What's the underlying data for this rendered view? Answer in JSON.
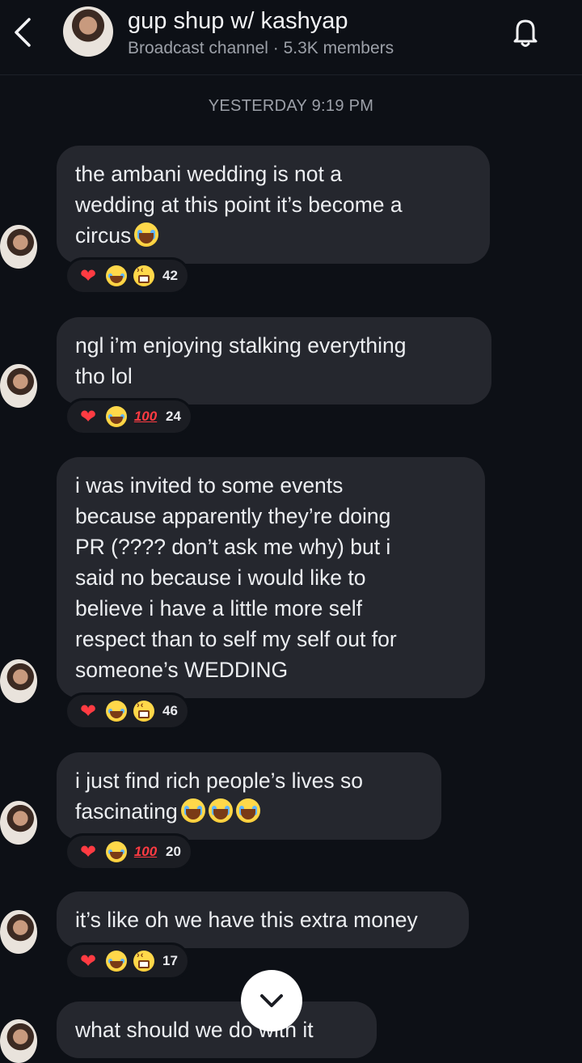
{
  "header": {
    "back_icon": "chevron-left-icon",
    "channel_name": "gup shup w/ kashyap",
    "subtitle": "Broadcast channel · 5.3K members",
    "bell_icon": "bell-icon"
  },
  "timestamp": "YESTERDAY 9:19 PM",
  "messages": [
    {
      "text": "the ambani wedding is not a\nwedding at this point it’s become a\ncircus",
      "emojis": [
        "loudly-crying-face"
      ],
      "reactions": [
        "heart",
        "face-with-tears-of-joy",
        "grinning-squinting-face"
      ],
      "count": "42"
    },
    {
      "text": "ngl i’m enjoying stalking everything\ntho lol",
      "emojis": [],
      "reactions": [
        "heart",
        "face-with-tears-of-joy",
        "hundred-points"
      ],
      "count": "24"
    },
    {
      "text": "i was invited to some events\nbecause apparently they’re doing\nPR (???? don’t ask me why) but i\nsaid no because i would like to\nbelieve i have a little more self\nrespect than to self my self out for\nsomeone’s WEDDING",
      "emojis": [],
      "reactions": [
        "heart",
        "face-with-tears-of-joy",
        "grinning-squinting-face"
      ],
      "count": "46"
    },
    {
      "text": "i just find rich people’s lives so\nfascinating",
      "emojis": [
        "loudly-crying-face",
        "loudly-crying-face",
        "loudly-crying-face"
      ],
      "reactions": [
        "heart",
        "face-with-tears-of-joy",
        "hundred-points"
      ],
      "count": "20"
    },
    {
      "text": "it’s like oh we have this extra money",
      "emojis": [],
      "reactions": [
        "heart",
        "face-with-tears-of-joy",
        "grinning-squinting-face"
      ],
      "count": "17"
    },
    {
      "text": "what should we do with it",
      "emojis": [],
      "reactions": [],
      "count": ""
    }
  ],
  "reaction_glyphs": {
    "heart": "❤",
    "hundred-points": "100"
  },
  "scroll_down_icon": "chevron-down-icon",
  "colors": {
    "background": "#0d1016",
    "bubble": "#25272e",
    "heart": "#ff3b42"
  }
}
